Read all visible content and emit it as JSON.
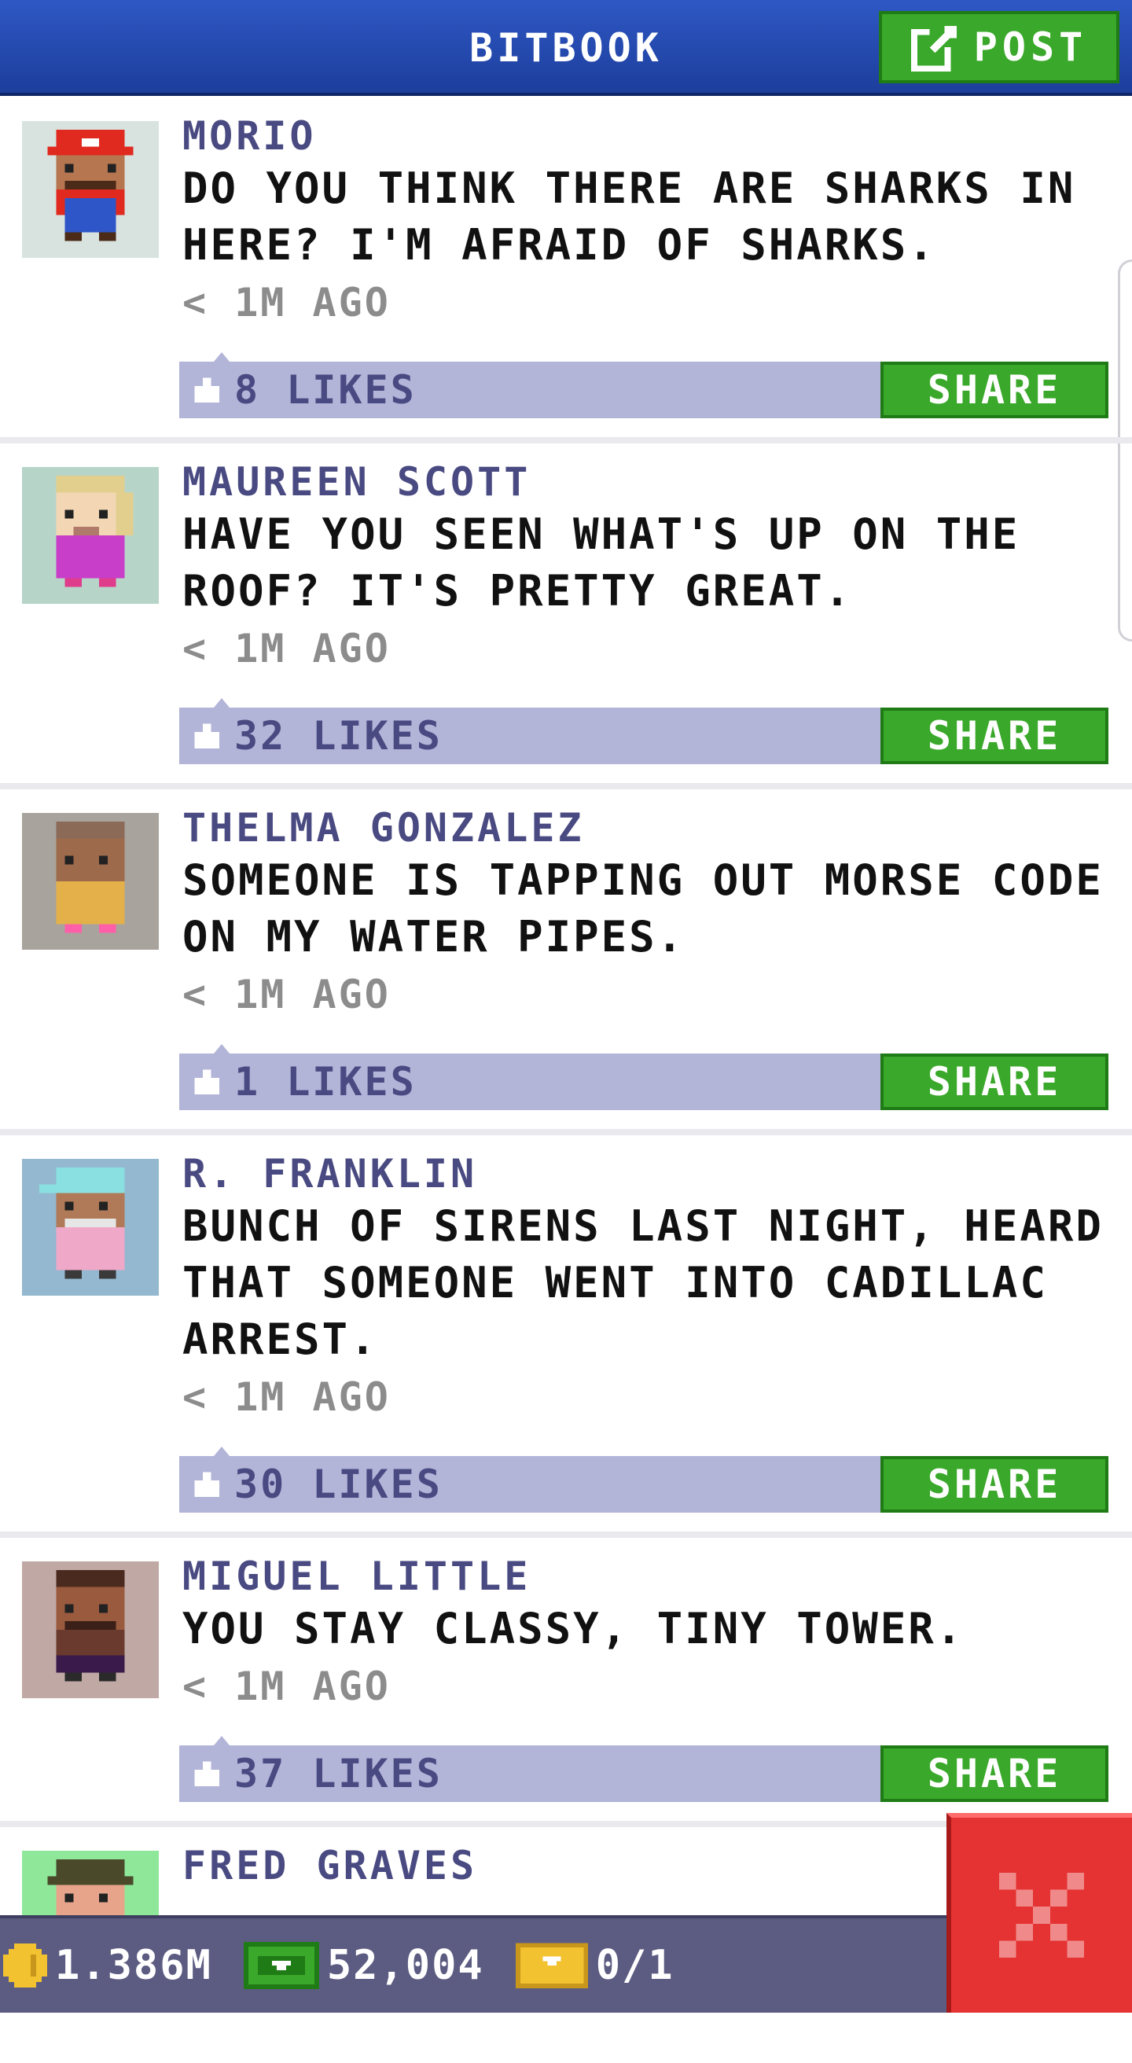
{
  "header": {
    "title": "BITBOOK",
    "post_label": "POST"
  },
  "posts": [
    {
      "name": "MORIO",
      "text": "DO YOU THINK THERE ARE SHARKS IN HERE? I'M AFRAID OF SHARKS.",
      "time": "< 1M AGO",
      "likes": "8 LIKES",
      "share_label": "SHARE",
      "avatar_bg": "#d8e3df"
    },
    {
      "name": "MAUREEN SCOTT",
      "text": "HAVE YOU SEEN WHAT'S UP ON THE ROOF? IT'S PRETTY GREAT.",
      "time": "< 1M AGO",
      "likes": "32 LIKES",
      "share_label": "SHARE",
      "avatar_bg": "#b7d4c9"
    },
    {
      "name": "THELMA GONZALEZ",
      "text": "SOMEONE IS TAPPING OUT MORSE CODE ON MY WATER PIPES.",
      "time": "< 1M AGO",
      "likes": "1 LIKES",
      "share_label": "SHARE",
      "avatar_bg": "#a8a39c"
    },
    {
      "name": "R. FRANKLIN",
      "text": "BUNCH OF SIRENS LAST NIGHT, HEARD THAT SOMEONE WENT INTO CADILLAC ARREST.",
      "time": "< 1M AGO",
      "likes": "30 LIKES",
      "share_label": "SHARE",
      "avatar_bg": "#93b8cf"
    },
    {
      "name": "MIGUEL LITTLE",
      "text": "YOU STAY CLASSY, TINY TOWER.",
      "time": "< 1M AGO",
      "likes": "37 LIKES",
      "share_label": "SHARE",
      "avatar_bg": "#c0a9a5"
    },
    {
      "name": "FRED GRAVES",
      "text": "",
      "time": "",
      "likes": "",
      "share_label": "",
      "avatar_bg": "#8fe89a"
    }
  ],
  "status_bar": {
    "coins": "1.386M",
    "bux": "52,004",
    "tickets": "0/1"
  },
  "colors": {
    "header": "#2448ad",
    "button_green": "#3aa82a",
    "like_bar": "#b2b4d8",
    "name": "#4a4a82",
    "close_red": "#e53232"
  }
}
